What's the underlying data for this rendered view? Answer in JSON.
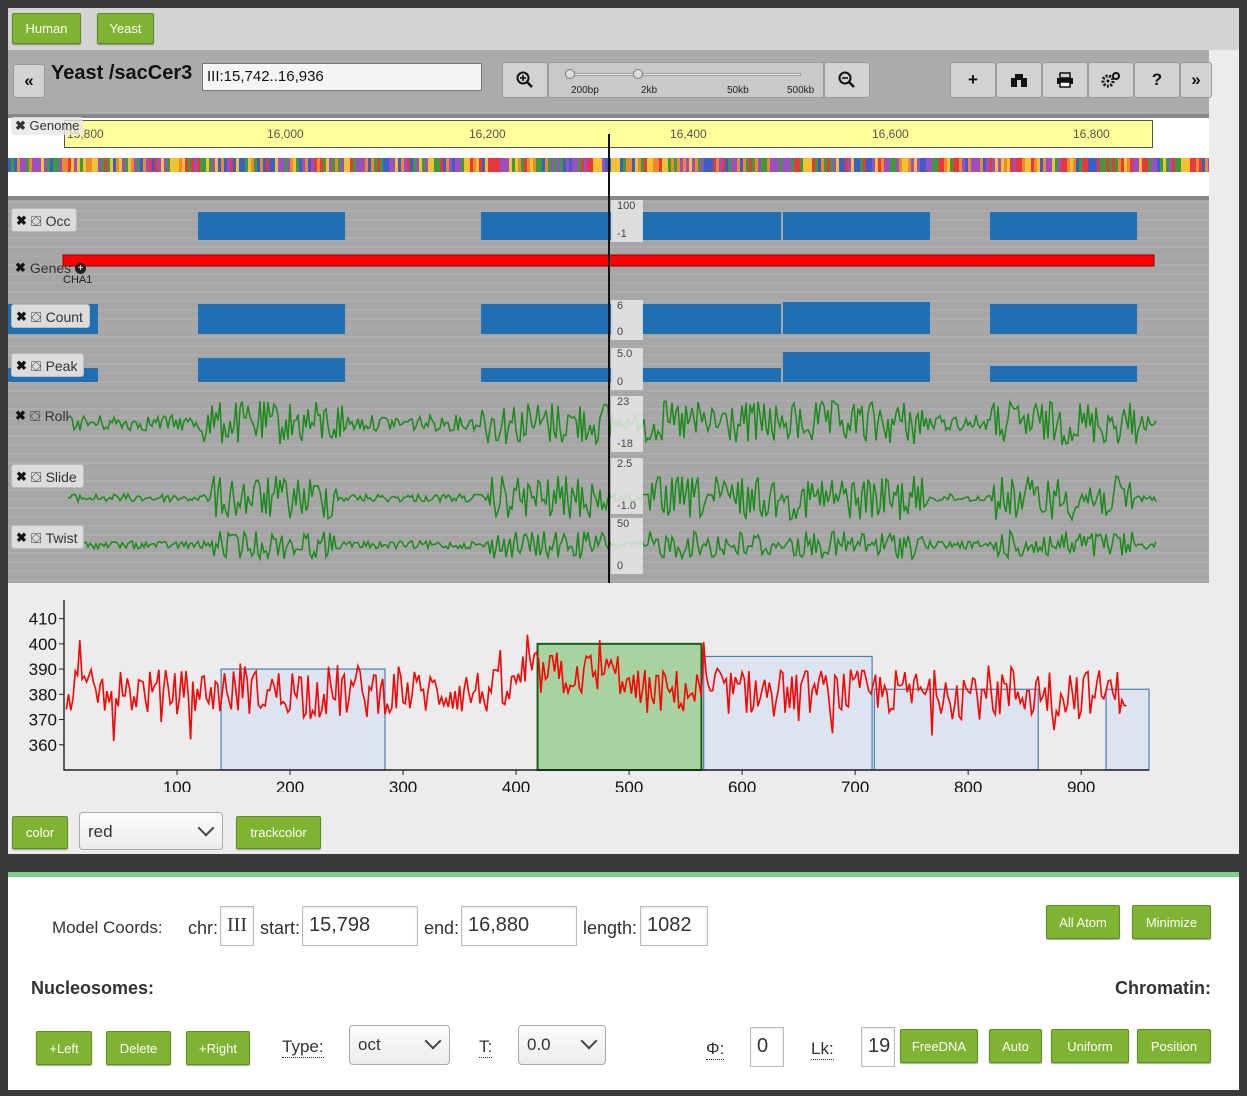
{
  "species": {
    "human_label": "Human",
    "yeast_label": "Yeast"
  },
  "nav": {
    "title": "Yeast /sacCer3",
    "location": "III:15,742..16,936",
    "zoom_labels": [
      "200bp",
      "2kb",
      "50kb",
      "500kb"
    ],
    "back_glyph": "«",
    "fwd_glyph": "»",
    "help_glyph": "?",
    "plus_glyph": "+"
  },
  "ruler": {
    "ticks": [
      "15,800",
      "16,000",
      "16,200",
      "16,400",
      "16,600",
      "16,800"
    ],
    "genome_label": "Genome"
  },
  "tracks": [
    {
      "name": "Occ",
      "scale_top": "100",
      "scale_bottom": "-1"
    },
    {
      "name": "Genes",
      "feature": "CHA1"
    },
    {
      "name": "Count",
      "scale_top": "6",
      "scale_bottom": "0"
    },
    {
      "name": "Peak",
      "scale_top": "5.0",
      "scale_bottom": "0"
    },
    {
      "name": "Roll",
      "scale_top": "23",
      "scale_bottom": "-18"
    },
    {
      "name": "Slide",
      "scale_top": "2.5",
      "scale_bottom": "-1.0"
    },
    {
      "name": "Twist",
      "scale_top": "50",
      "scale_bottom": "0"
    }
  ],
  "colors": {
    "feature_blue": "#1f6fb5",
    "gene_red": "#ff0000",
    "signal_green": "#1a8a1a",
    "accent_green": "#7fb432"
  },
  "chart_data": {
    "type": "line",
    "series": [
      {
        "values_note": "noisy signal",
        "color": "#ff0000"
      }
    ],
    "ylim": [
      350,
      415
    ],
    "xlim": [
      0,
      960
    ],
    "yticks": [
      360,
      370,
      380,
      390,
      400,
      410
    ],
    "xticks": [
      100,
      200,
      300,
      400,
      500,
      600,
      700,
      800,
      900
    ],
    "boxes": [
      {
        "x0": 139,
        "x1": 284,
        "y": 390,
        "color": "#dbe4ef"
      },
      {
        "x0": 419,
        "x1": 564,
        "y": 400,
        "color": "#a6d3a0",
        "highlight": true
      },
      {
        "x0": 566,
        "x1": 715,
        "y": 395,
        "color": "#dbe4ef"
      },
      {
        "x0": 717,
        "x1": 862,
        "y": 382,
        "color": "#dbe4ef"
      },
      {
        "x0": 922,
        "x1": 960,
        "y": 382,
        "color": "#dbe4ef"
      }
    ]
  },
  "controls": {
    "color_label": "color",
    "color_value": "red",
    "trackcolor_label": "trackcolor"
  },
  "model": {
    "coords_label": "Model Coords:",
    "chr_label": "chr:",
    "chr_value": "III",
    "start_label": "start:",
    "start_value": "15,798",
    "end_label": "end:",
    "end_value": "16,880",
    "length_label": "length:",
    "length_value": "1082",
    "all_atom_label": "All Atom",
    "minimize_label": "Minimize",
    "nucleosomes_label": "Nucleosomes:",
    "chromatin_label": "Chromatin:",
    "left_label": "+Left",
    "delete_label": "Delete",
    "right_label": "+Right",
    "type_label": "Type:",
    "type_value": "oct",
    "t_label": "T:",
    "t_value": "0.0",
    "phi_label": "Φ:",
    "phi_value": "0",
    "lk_label": "Lk:",
    "lk_value": "19",
    "freedna_label": "FreeDNA",
    "auto_label": "Auto",
    "uniform_label": "Uniform",
    "position_label": "Position"
  }
}
